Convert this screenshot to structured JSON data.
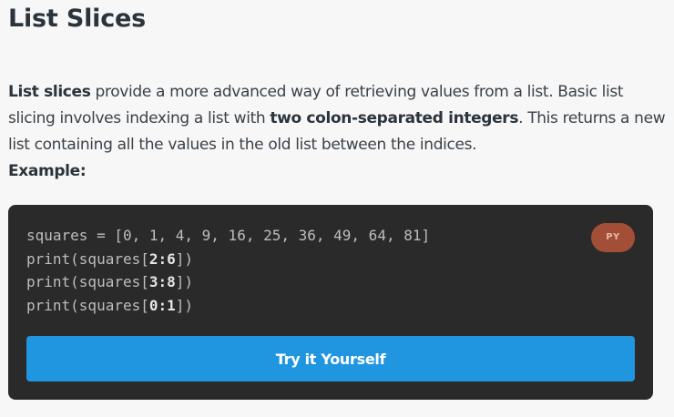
{
  "section": {
    "title": "List Slices"
  },
  "paragraph": {
    "term": "List slices",
    "text1": " provide a more advanced way of retrieving values from a list. Basic list slicing involves indexing a list with ",
    "emphasis": "two colon-separated integers",
    "text2": ". This returns a new list containing all the values in the old list between the indices.",
    "example_label": "Example:"
  },
  "code_block": {
    "language_badge": "PY",
    "lines": [
      {
        "text": "squares = [0, 1, 4, 9, 16, 25, 36, 49, 64, 81]"
      },
      {
        "pre": "print(squares[",
        "bold": "2:6",
        "post": "])"
      },
      {
        "pre": "print(squares[",
        "bold": "3:8",
        "post": "])"
      },
      {
        "pre": "print(squares[",
        "bold": "0:1",
        "post": "])"
      }
    ],
    "button_label": "Try it Yourself"
  },
  "colors": {
    "page_background": "#f7f7f7",
    "code_background": "#2a2a2a",
    "badge_background": "#a34e36",
    "button_background": "#2196e0"
  }
}
